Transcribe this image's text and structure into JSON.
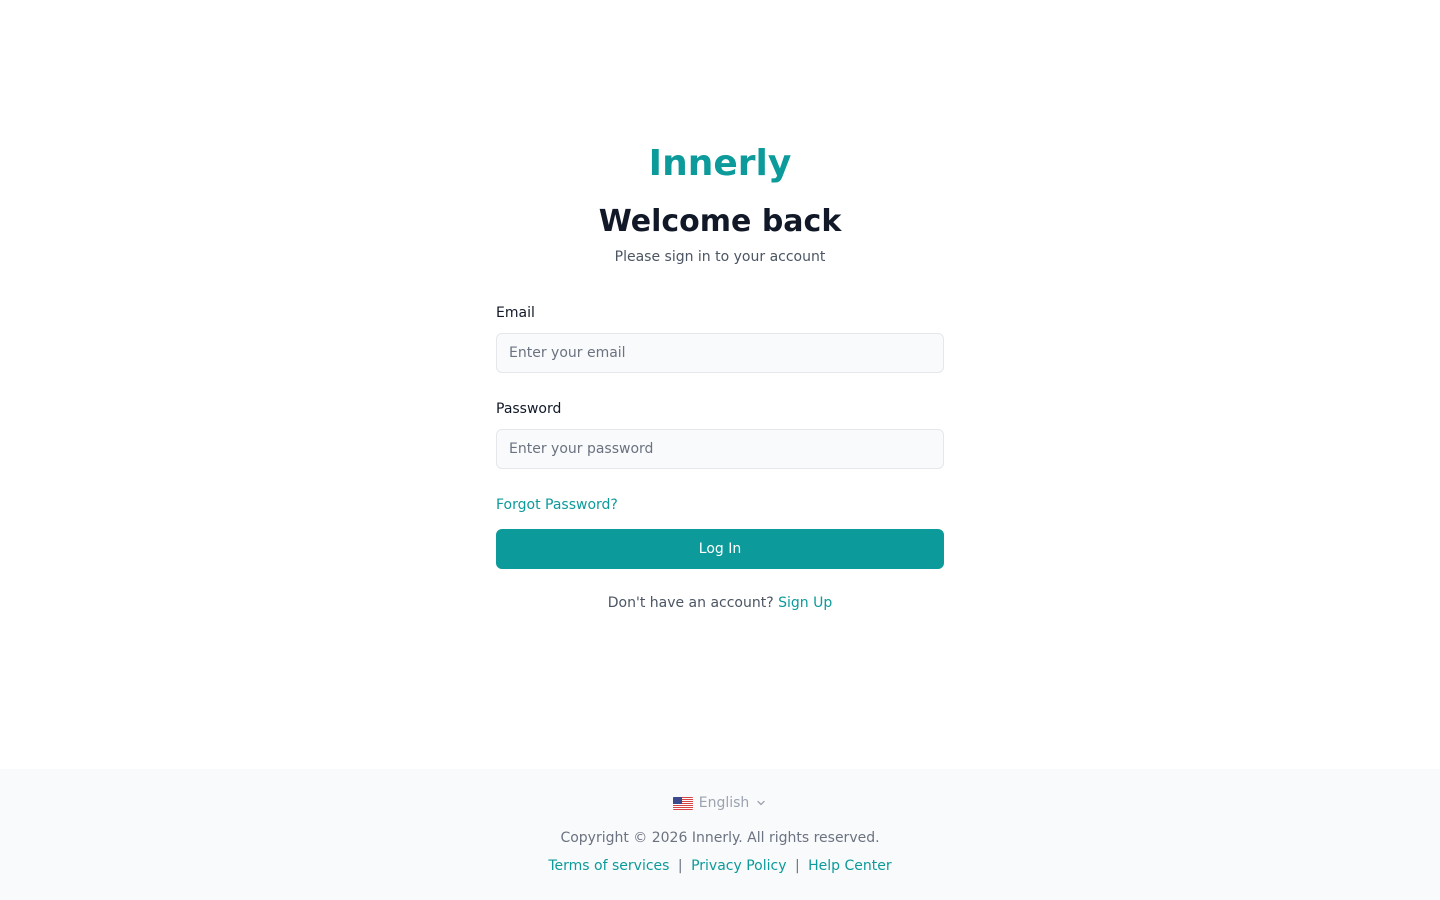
{
  "brand": {
    "name": "Innerly",
    "color": "#0c9a9a"
  },
  "login": {
    "title": "Welcome back",
    "subtitle": "Please sign in to your account",
    "email_label": "Email",
    "email_placeholder": "Enter your email",
    "email_value": "",
    "password_label": "Password",
    "password_placeholder": "Enter your password",
    "password_value": "",
    "forgot_label": "Forgot Password?",
    "login_button_label": "Log In",
    "signup_prompt": "Don't have an account?",
    "signup_link_label": "Sign Up"
  },
  "footer": {
    "language": {
      "flag_icon": "us-flag-icon",
      "label": "English",
      "chevron_icon": "chevron-down-icon"
    },
    "copyright": "Copyright © 2026 Innerly. All rights reserved.",
    "links": [
      {
        "label": "Terms of services"
      },
      {
        "label": "Privacy Policy"
      },
      {
        "label": "Help Center"
      }
    ],
    "separator": "|"
  },
  "colors": {
    "accent": "#0c9a9a",
    "footer_bg": "#f9fafb",
    "heading": "#111827",
    "muted": "#4b5563"
  }
}
